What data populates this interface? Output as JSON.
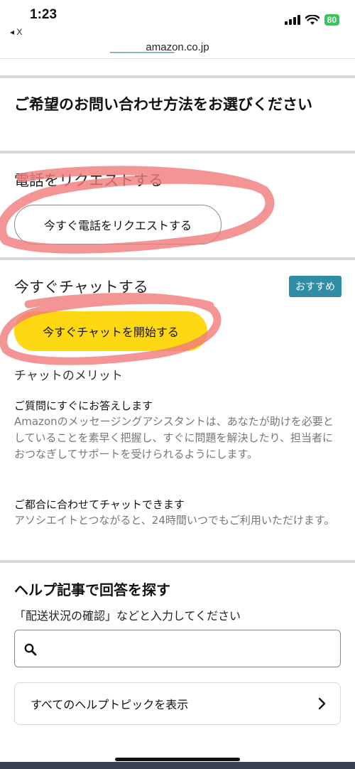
{
  "status_bar": {
    "time": "1:23",
    "back_label": "◂ X",
    "battery": "80",
    "url": "amazon.co.jp"
  },
  "contact": {
    "heading": "ご希望のお問い合わせ方法をお選びください"
  },
  "phone": {
    "heading": "電話をリクエストする",
    "button_label": "今すぐ電話をリクエストする"
  },
  "chat": {
    "heading": "今すぐチャットする",
    "badge": "おすすめ",
    "button_label": "今すぐチャットを開始する",
    "merit_title": "チャットのメリット",
    "merits": [
      {
        "title": "ご質問にすぐにお答えします",
        "body": "Amazonのメッセージングアシスタントは、あなたが助けを必要としていることを素早く把握し、すぐに問題を解決したり、担当者におつなぎしてサポートを受けられるようにします。"
      },
      {
        "title": "ご都合に合わせてチャットできます",
        "body": "アソシエイトとつながると、24時間いつでもご利用いただけます。"
      }
    ]
  },
  "help": {
    "heading": "ヘルプ記事で回答を探す",
    "hint": "「配送状況の確認」などと入力してください",
    "search_value": "",
    "all_topics_label": "すべてのヘルプトピックを表示"
  },
  "colors": {
    "accent_yellow": "#ffd814",
    "badge_teal": "#2f8ea6",
    "annotation_red": "#f07a7a"
  },
  "icons": {
    "search": "search-icon",
    "chevron": "chevron-right-icon"
  }
}
